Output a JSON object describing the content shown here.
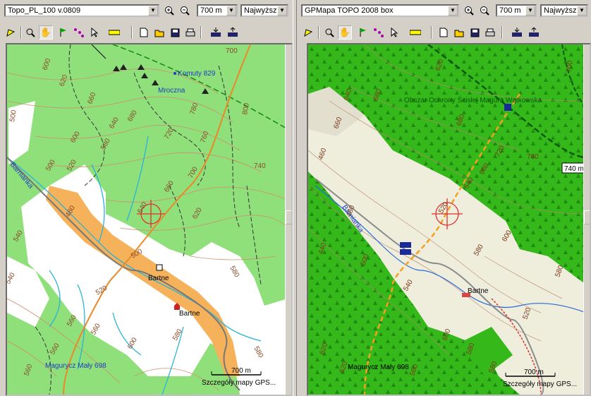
{
  "left": {
    "map_source": "Topo_PL_100 v.0809",
    "zoom_value": "700 m",
    "detail_level": "Najwyższe",
    "scale_label": "700 m",
    "status": "Szczegóły mapy GPS...",
    "labels": {
      "komuty": "Komuty 829",
      "mroczna": "Mroczna",
      "barnianka": "Barnianka",
      "bartne1": "Bartne",
      "bartne2": "Bartne",
      "magurycz": "Magurycz Mały 698",
      "contours": [
        "600",
        "700",
        "620",
        "660",
        "680",
        "640",
        "600",
        "580",
        "780",
        "800",
        "720",
        "760",
        "740",
        "700",
        "660",
        "620",
        "500",
        "520",
        "480",
        "540",
        "640",
        "500",
        "520",
        "580",
        "560",
        "560",
        "540",
        "580",
        "560",
        "600",
        "580",
        "500",
        "560",
        "580",
        "560",
        "560",
        "600",
        "580",
        "560"
      ]
    }
  },
  "right": {
    "map_source": "GPMapa TOPO 2008 box",
    "zoom_value": "700 m",
    "detail_level": "Najwyższe",
    "scale_label": "700 m",
    "elevation_tag": "740 m",
    "status": "Szczegóły mapy GPS...",
    "labels": {
      "obszar": "Obszar Ochrony Ścisłej Magura Wątkowska",
      "barnianka": "Barnianka",
      "bartne": "Bartne",
      "magurycz": "Magurycz Mały 698",
      "contours": [
        "620",
        "640",
        "680",
        "660",
        "680",
        "700",
        "720",
        "760",
        "480",
        "460",
        "440",
        "520",
        "640",
        "660",
        "600",
        "580",
        "500",
        "520",
        "540",
        "620",
        "580",
        "600",
        "620",
        "560",
        "580",
        "580"
      ]
    }
  },
  "colors": {
    "left_forest": "#8fe07a",
    "left_open": "#ffffff",
    "left_village": "#f5b25a",
    "right_forest": "#34b81a",
    "right_open": "#efeedd"
  }
}
